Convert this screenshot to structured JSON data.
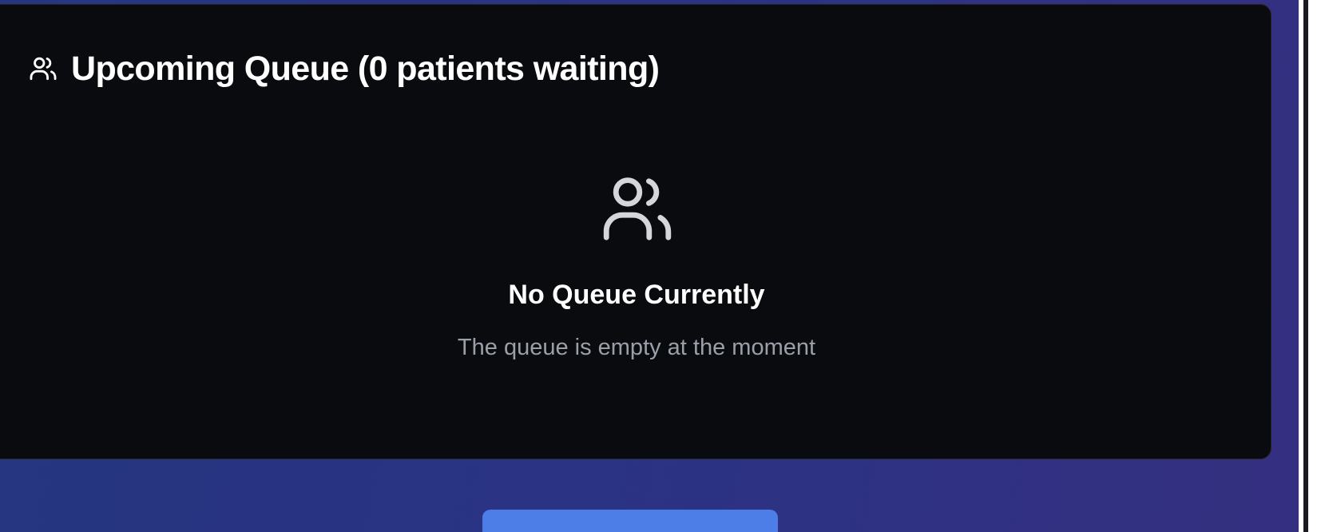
{
  "queue_panel": {
    "title": "Upcoming Queue (0 patients waiting)",
    "title_icon": "users-icon"
  },
  "empty_state": {
    "icon": "users-icon",
    "title": "No Queue Currently",
    "subtitle": "The queue is empty at the moment"
  },
  "colors": {
    "background_start": "#25367f",
    "background_end": "#352f80",
    "card": "#0a0b0e",
    "subtitle_text": "#9aa0aa",
    "button": "#4d7ee8"
  }
}
